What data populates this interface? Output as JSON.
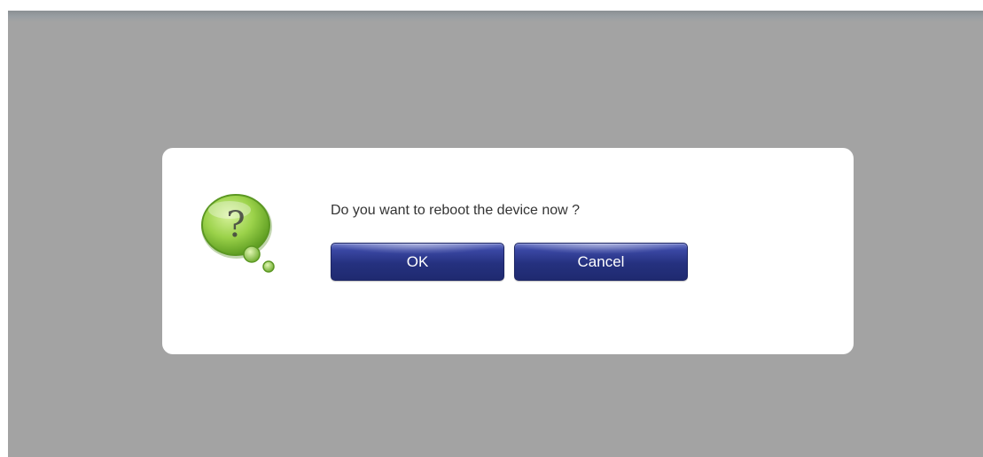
{
  "dialog": {
    "message": "Do you want to reboot the device now ?",
    "icon": "question-bubble-icon",
    "ok_label": "OK",
    "cancel_label": "Cancel"
  },
  "colors": {
    "overlay": "#a3a3a3",
    "dialog_background": "#ffffff",
    "button": "#25317f",
    "icon_green": "#8cc63f"
  }
}
